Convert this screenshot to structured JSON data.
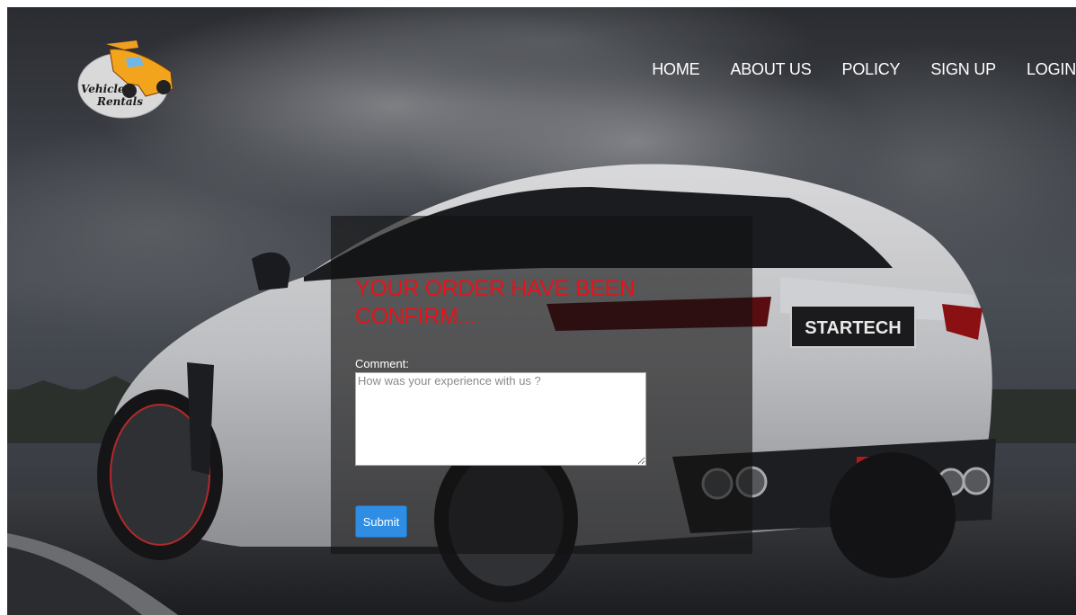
{
  "logo": {
    "line1": "Vehicle",
    "line2": "Rentals"
  },
  "nav": {
    "items": [
      {
        "label": "HOME"
      },
      {
        "label": "ABOUT US"
      },
      {
        "label": "POLICY"
      },
      {
        "label": "SIGN UP"
      },
      {
        "label": "LOGIN"
      }
    ]
  },
  "hero": {
    "car_badge": "STARTECH"
  },
  "confirmation": {
    "title": "YOUR ORDER HAVE BEEN CONFIRM...",
    "comment_label": "Comment:",
    "comment_placeholder": "How was your experience with us ?",
    "comment_value": "",
    "submit_label": "Submit"
  },
  "colors": {
    "title_red": "#e3141b",
    "button_blue": "#2f8ee3",
    "nav_text": "#ffffff",
    "panel_overlay": "rgba(18,18,18,0.62)"
  }
}
